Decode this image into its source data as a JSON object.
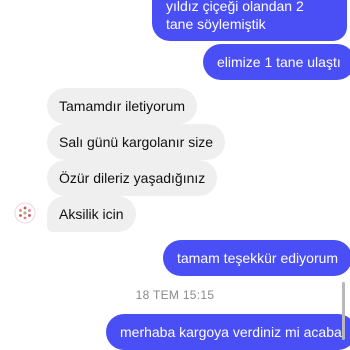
{
  "conversation": {
    "messages": [
      {
        "direction": "outgoing",
        "text": "yıldız çiçeği olandan 2 tane söylemiştik"
      },
      {
        "direction": "outgoing",
        "text": "elimize 1 tane ulaştı"
      },
      {
        "direction": "incoming",
        "text": "Tamamdır iletiyorum"
      },
      {
        "direction": "incoming",
        "text": "Salı günü kargolanır size"
      },
      {
        "direction": "incoming",
        "text": "Özür dileriz yaşadığınız"
      },
      {
        "direction": "incoming",
        "text": "Aksilik icin"
      },
      {
        "direction": "outgoing",
        "text": "tamam teşekkür ediyorum"
      },
      {
        "direction": "outgoing",
        "text": "merhaba kargoya verdiniz mi acaba"
      }
    ],
    "timestamp": "18 TEM 15:15"
  },
  "colors": {
    "outgoing_bubble": "#4a4ef5",
    "incoming_bubble": "#efeff0",
    "avatar_accent": "#d94b63"
  },
  "icons": {
    "avatar": "floral-logo-avatar"
  }
}
